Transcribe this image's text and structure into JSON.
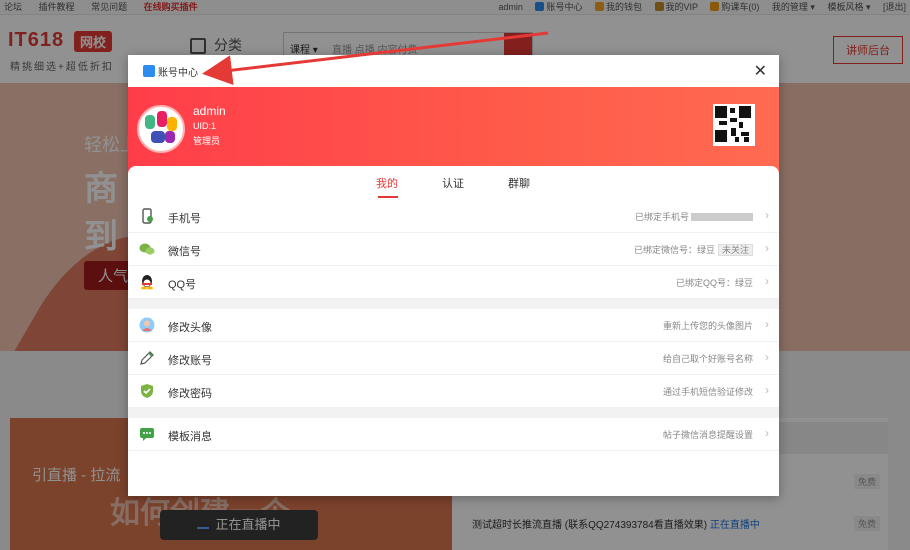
{
  "topbar": {
    "left": [
      "论坛",
      "插件教程",
      "常见问题",
      "在线购买插件"
    ],
    "right": [
      "admin",
      "账号中心",
      "我的钱包",
      "我的VIP",
      "购课车(0)",
      "我的管理 ▾",
      "模板风格 ▾",
      "[退出]"
    ]
  },
  "header": {
    "logo": "IT618",
    "logo_badge": "网校",
    "slogan": "精挑细选+超低折扣",
    "category": "分类",
    "search_select": "课程 ▾",
    "search_placeholder": "直播 点播 内容付费",
    "teacher_btn": "讲师后台"
  },
  "banner": {
    "line1": "轻松上",
    "line2": "商",
    "line3": "到",
    "pill": "人气"
  },
  "lower": {
    "left_title": "引直播 - 拉流",
    "left_big": "如何创建一个",
    "live_btn": "正在直播中",
    "right_tag1": "免费",
    "right_tag2": "免费",
    "right_item": "测试超时长推流直播 (联系QQ274393784看直播效果)",
    "right_item_status": "正在直播中"
  },
  "modal": {
    "title": "账号中心",
    "close": "✕",
    "user": {
      "name": "admin",
      "uid": "UID:1",
      "role": "管理员"
    },
    "tabs": [
      "我的",
      "认证",
      "群聊"
    ],
    "active_tab": "我的",
    "rows": [
      {
        "label": "手机号",
        "value": "已绑定手机号",
        "icon": "phone-icon"
      },
      {
        "label": "微信号",
        "value": "已绑定微信号：绿豆",
        "tag": "未关注",
        "icon": "wechat-icon"
      },
      {
        "label": "QQ号",
        "value": "已绑定QQ号：绿豆",
        "icon": "qq-icon"
      },
      {
        "label": "修改头像",
        "value": "重新上传您的头像图片",
        "icon": "avatar-edit-icon"
      },
      {
        "label": "修改账号",
        "value": "给自己取个好账号名称",
        "icon": "pencil-icon"
      },
      {
        "label": "修改密码",
        "value": "通过手机短信验证修改",
        "icon": "shield-icon"
      },
      {
        "label": "模板消息",
        "value": "帖子微信消息提醒设置",
        "icon": "message-icon"
      }
    ]
  },
  "colors": {
    "accent": "#e53935",
    "hero_start": "#ff3d4a",
    "hero_end": "#ff6a52"
  }
}
